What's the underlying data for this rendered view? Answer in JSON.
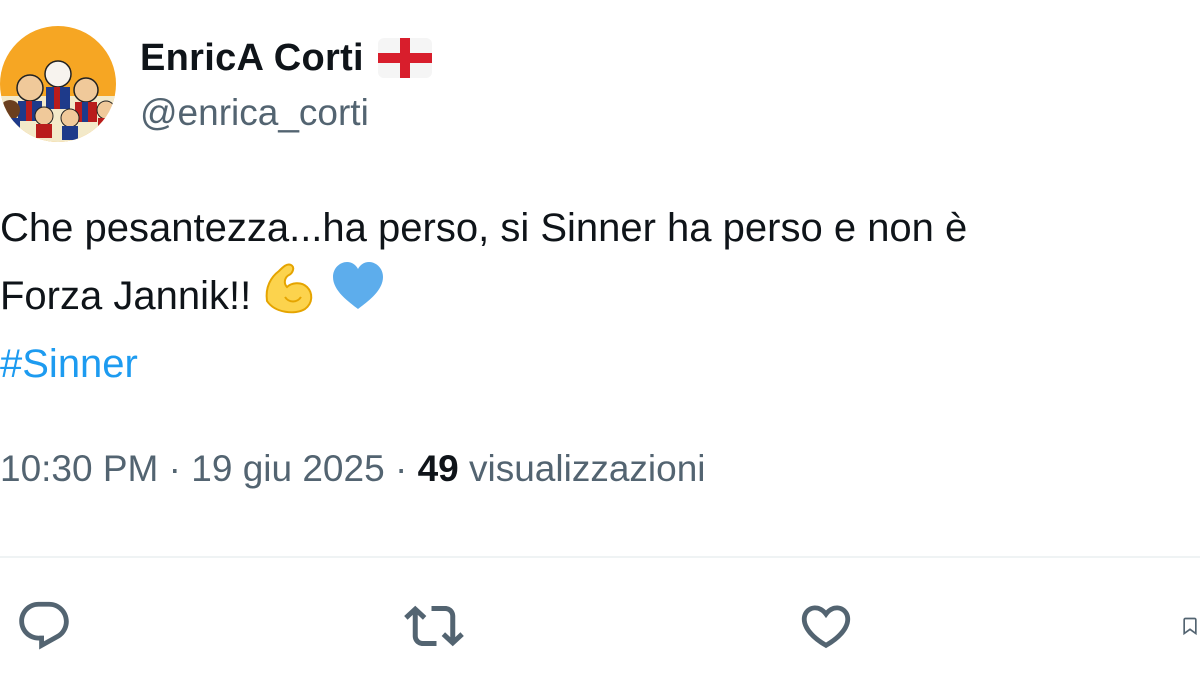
{
  "author": {
    "display_name": "EnricA Corti",
    "handle": "@enrica_corti",
    "flag_icon": "england-flag-icon",
    "avatar_icon": "cartoon-group-avatar"
  },
  "tweet": {
    "line1": "Che pesantezza...ha perso, si Sinner ha perso e non è",
    "line2": "Forza Jannik!!",
    "line2_emojis": [
      "flexed-biceps-icon",
      "blue-heart-icon"
    ],
    "hashtag": "#Sinner"
  },
  "meta": {
    "time": "10:30 PM",
    "separator": "·",
    "date": "19 giu 2025",
    "views_count": "49",
    "views_label": "visualizzazioni"
  },
  "actions": [
    "reply-icon",
    "retweet-icon",
    "like-icon",
    "bookmark-icon"
  ],
  "colors": {
    "text": "#0f1419",
    "secondary": "#536471",
    "link": "#1d9bf0",
    "divider": "#eff3f4"
  }
}
